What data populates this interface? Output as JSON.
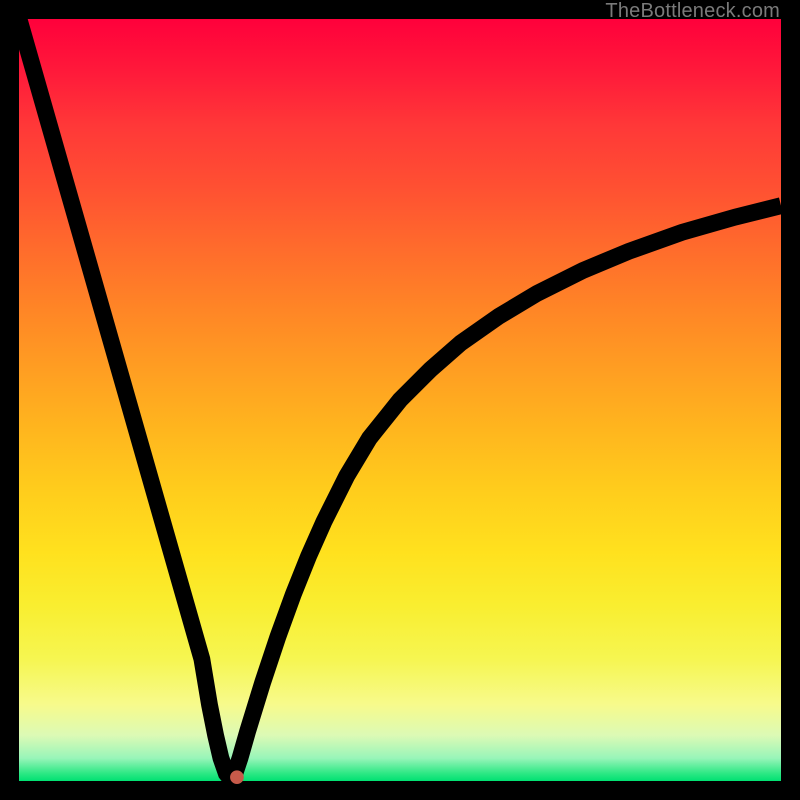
{
  "watermark": "TheBottleneck.com",
  "chart_data": {
    "type": "line",
    "title": "",
    "xlabel": "",
    "ylabel": "",
    "xlim": [
      0,
      100
    ],
    "ylim": [
      0,
      100
    ],
    "grid": false,
    "series": [
      {
        "name": "left-branch",
        "x": [
          0,
          2,
          4,
          6,
          8,
          10,
          12,
          14,
          16,
          18,
          20,
          22,
          24,
          25,
          25.8,
          26.5,
          27.2,
          28
        ],
        "y": [
          100,
          93,
          86,
          79,
          72,
          65,
          58,
          51,
          44,
          37,
          30,
          23,
          16,
          10,
          6,
          3,
          1,
          0
        ]
      },
      {
        "name": "right-branch",
        "x": [
          28,
          29,
          30,
          32,
          34,
          36,
          38,
          40,
          43,
          46,
          50,
          54,
          58,
          63,
          68,
          74,
          80,
          87,
          94,
          100
        ],
        "y": [
          0,
          3,
          6.5,
          13,
          19,
          24.5,
          29.5,
          34,
          40,
          45,
          50,
          54,
          57.5,
          61,
          64,
          67,
          69.5,
          72,
          74,
          75.5
        ]
      }
    ],
    "marker": {
      "x": 28.6,
      "y": 0.5
    },
    "colors": {
      "gradient_top": "#ff003b",
      "gradient_bottom": "#00e172",
      "curve": "#000000",
      "dot": "#c65a4a"
    }
  }
}
